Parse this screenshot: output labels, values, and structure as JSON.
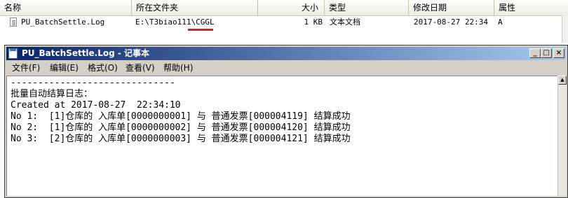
{
  "results": {
    "columns": [
      "名称",
      "所在文件夹",
      "大小",
      "类型",
      "修改日期",
      "属性"
    ],
    "row": {
      "name": "PU_BatchSettle.Log",
      "folder": "E:\\T3biao111\\CGGL",
      "size": "1 KB",
      "type": "文本文档",
      "modified": "2017-08-27 22:34",
      "attr": "A"
    },
    "underline_color": "#e02020"
  },
  "notepad": {
    "title": "PU_BatchSettle.Log - 记事本",
    "menu": [
      "文件(F)",
      "编辑(E)",
      "格式(O)",
      "查看(V)",
      "帮助(H)"
    ],
    "lines": [
      "------------------------------",
      "批量自动结算日志：",
      "Created at 2017-08-27  22:34:10",
      "No 1:  [1]仓库的 入库单[0000000001] 与 普通发票[000004119] 结算成功",
      "No 2:  [1]仓库的 入库单[0000000002] 与 普通发票[000004120] 结算成功",
      "No 3:  [2]仓库的 入库单[0000000003] 与 普通发票[000004121] 结算成功"
    ],
    "title_gradient": [
      "#0a246a",
      "#a6caf0"
    ]
  }
}
